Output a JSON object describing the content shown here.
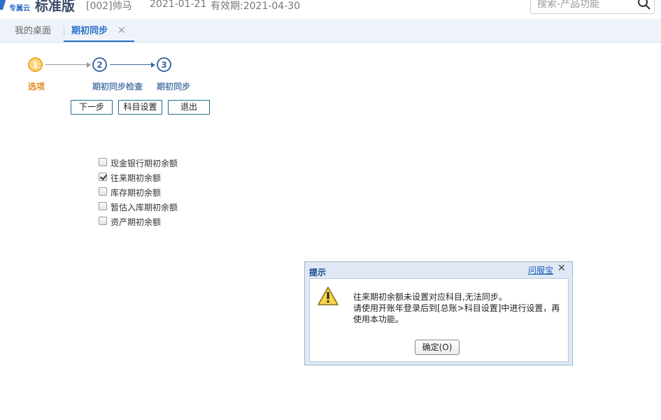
{
  "header": {
    "logo_text": "专属云",
    "edition": "标准版",
    "account": "[002]帅马",
    "date": "2021-01-21",
    "validity": "有效期:2021-04-30",
    "search_placeholder": "搜索-产品功能"
  },
  "tabs": [
    {
      "label": "我的桌面",
      "active": false
    },
    {
      "label": "期初同步",
      "active": true,
      "close": "✕"
    }
  ],
  "steps": [
    {
      "number": "1",
      "label": "选项",
      "state": "current"
    },
    {
      "number": "2",
      "label": "期初同步检查",
      "state": "pending"
    },
    {
      "number": "3",
      "label": "期初同步",
      "state": "pending"
    }
  ],
  "buttons": {
    "next": "下一步",
    "subject_settings": "科目设置",
    "exit": "退出"
  },
  "options": [
    {
      "label": "现金银行期初余额",
      "checked": false
    },
    {
      "label": "往来期初余额",
      "checked": true
    },
    {
      "label": "库存期初余额",
      "checked": false
    },
    {
      "label": "暂估入库期初余额",
      "checked": false
    },
    {
      "label": "资产期初余额",
      "checked": false
    }
  ],
  "dialog": {
    "title": "提示",
    "help_link": "问服宝",
    "close": "✕",
    "message_lines": [
      "往来期初余额未设置对应科目,无法同步。",
      "请使用开账年登录后到[总账>科目设置]中进行设置，再",
      "使用本功能。"
    ],
    "ok_label": "确定(O)"
  },
  "colors": {
    "accent": "#2a6fc9",
    "step_current": "#f0a72b",
    "step_pending": "#3d6aa0",
    "dialog_title": "#15428b"
  }
}
